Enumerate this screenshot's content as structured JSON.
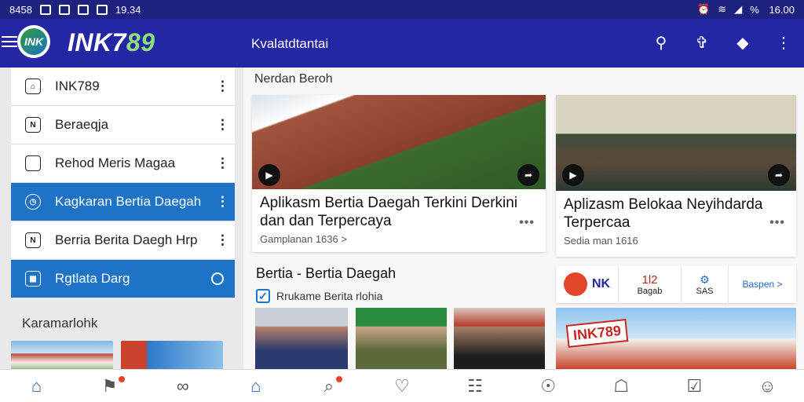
{
  "status": {
    "left_text": "8458",
    "time_mid": "19.34",
    "battery": "% ",
    "time": "16.00"
  },
  "app": {
    "brand_prefix": "INK7",
    "brand_hl": "89",
    "logo_text": "INK",
    "subtitle": "Kvalatdtantai"
  },
  "sidebar": {
    "items": [
      {
        "label": "INK789",
        "active": false
      },
      {
        "label": "Beraeqja",
        "active": false
      },
      {
        "label": "Rehod Meris Magaa",
        "active": false
      },
      {
        "label": "Kagkaran Bertia Daegah",
        "active": true
      },
      {
        "label": "Berria Berita Daegh Hrp",
        "active": false
      },
      {
        "label": "Rgtlata Darg",
        "active": true
      }
    ],
    "section": "Karamarlohk"
  },
  "main": {
    "section_title": "Nerdan Beroh",
    "card1": {
      "title": "Aplikasm Bertia Daegah Terkini Derkini dan dan Terpercaya",
      "meta": "Gamplanan 1636 >"
    },
    "card2": {
      "title": "Aplizasm Belokaa Neyihdarda Terpercaa",
      "meta": "Sedia man 1616"
    },
    "heading2": "Bertia - Bertia Daegah",
    "check_label": "Rrukame Berita rlohia",
    "promo": {
      "a": "NK",
      "b_top": "1l2",
      "b_bot": "Bagab",
      "c": "SAS",
      "d": "Baspen >"
    },
    "banner_text": "INK789"
  },
  "bottom_nav": [
    {
      "name": "home",
      "glyph": "⌂"
    },
    {
      "name": "notify",
      "glyph": "⚑"
    },
    {
      "name": "share",
      "glyph": "∞"
    },
    {
      "name": "home2",
      "glyph": "⌂"
    },
    {
      "name": "search",
      "glyph": "⌕"
    },
    {
      "name": "heart",
      "glyph": "♡"
    },
    {
      "name": "book",
      "glyph": "☷"
    },
    {
      "name": "compass",
      "glyph": "☉"
    },
    {
      "name": "bank",
      "glyph": "☖"
    },
    {
      "name": "check",
      "glyph": "☑"
    },
    {
      "name": "person",
      "glyph": "☺"
    }
  ]
}
